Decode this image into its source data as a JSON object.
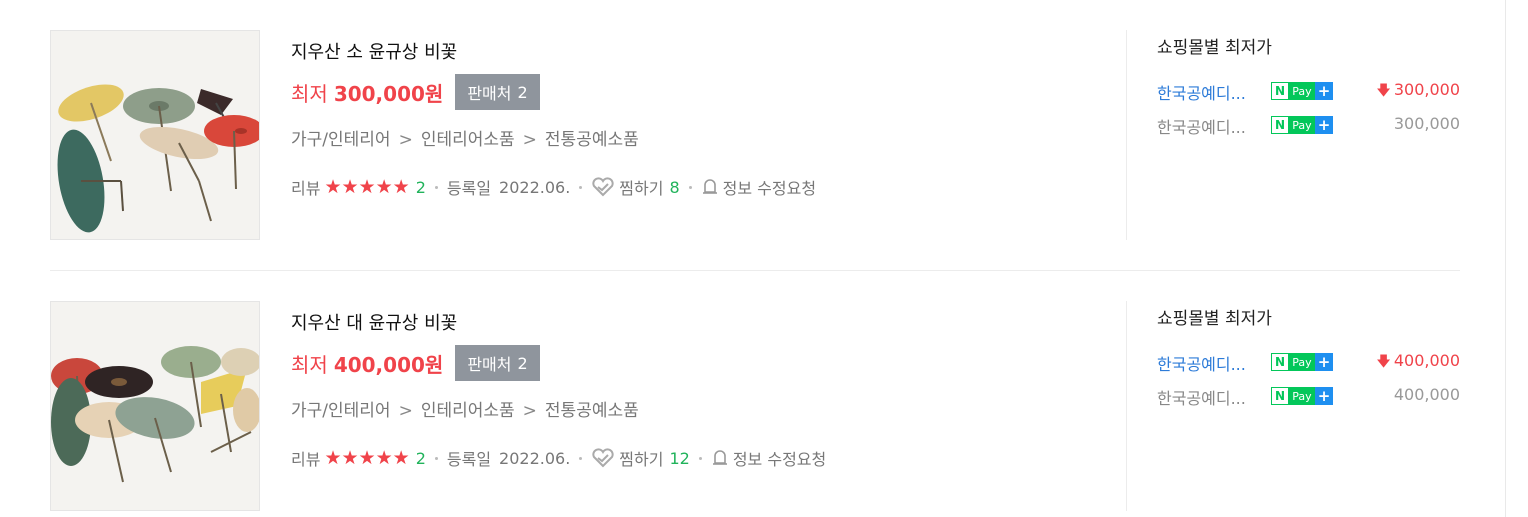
{
  "items": [
    {
      "title": "지우산 소 윤규상 비꽃",
      "price_prefix": "최저",
      "price": "300,000원",
      "sellers_label": "판매처",
      "sellers_count": "2",
      "category": [
        "가구/인테리어",
        "인테리어소품",
        "전통공예소품"
      ],
      "category_sep": ">",
      "review_label": "리뷰",
      "review_count": "2",
      "registered_label": "등록일",
      "registered_date": "2022.06.",
      "zzim_label": "찜하기",
      "zzim_count": "8",
      "report_label": "정보 수정요청",
      "mall_title": "쇼핑몰별 최저가",
      "malls": [
        {
          "name": "한국공예디...",
          "pay": "Pay",
          "price": "300,000",
          "lowest": true
        },
        {
          "name": "한국공예디...",
          "pay": "Pay",
          "price": "300,000",
          "lowest": false
        }
      ]
    },
    {
      "title": "지우산 대 윤규상 비꽃",
      "price_prefix": "최저",
      "price": "400,000원",
      "sellers_label": "판매처",
      "sellers_count": "2",
      "category": [
        "가구/인테리어",
        "인테리어소품",
        "전통공예소품"
      ],
      "category_sep": ">",
      "review_label": "리뷰",
      "review_count": "2",
      "registered_label": "등록일",
      "registered_date": "2022.06.",
      "zzim_label": "찜하기",
      "zzim_count": "12",
      "report_label": "정보 수정요청",
      "mall_title": "쇼핑몰별 최저가",
      "malls": [
        {
          "name": "한국공예디...",
          "pay": "Pay",
          "price": "400,000",
          "lowest": true
        },
        {
          "name": "한국공예디...",
          "pay": "Pay",
          "price": "400,000",
          "lowest": false
        }
      ]
    }
  ],
  "icons": {
    "star": "star-icon",
    "heart": "heart-icon",
    "bell": "bell-icon",
    "npay": "npay-badge",
    "down": "down-arrow-icon"
  },
  "colors": {
    "price_red": "#f0434a",
    "count_green": "#21b35b",
    "mall_blue": "#2d7bd8",
    "naver_green": "#03c75a",
    "plus_blue": "#1e8ff0",
    "sellers_gray": "#8f959d"
  },
  "rating_stars": 5
}
